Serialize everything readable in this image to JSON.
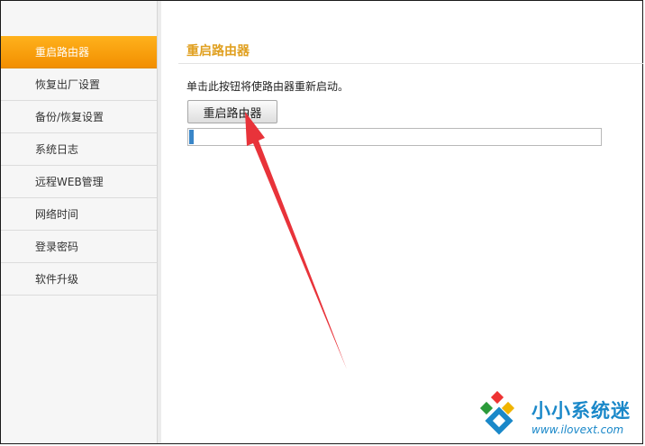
{
  "sidebar": {
    "items": [
      {
        "label": "重启路由器",
        "active": true
      },
      {
        "label": "恢复出厂设置",
        "active": false
      },
      {
        "label": "备份/恢复设置",
        "active": false
      },
      {
        "label": "系统日志",
        "active": false
      },
      {
        "label": "远程WEB管理",
        "active": false
      },
      {
        "label": "网络时间",
        "active": false
      },
      {
        "label": "登录密码",
        "active": false
      },
      {
        "label": "软件升级",
        "active": false
      }
    ]
  },
  "main": {
    "title": "重启路由器",
    "description": "单击此按钮将使路由器重新启动。",
    "reboot_button_label": "重启路由器",
    "progress_fraction": 0.01
  },
  "watermark": {
    "brand": "小小系统迷",
    "url": "www.ilovext.com"
  },
  "colors": {
    "accent": "#f5a000",
    "title": "#e0a020",
    "progress": "#3a86c8",
    "arrow": "#e8333a",
    "watermark": "#1a88c9"
  }
}
